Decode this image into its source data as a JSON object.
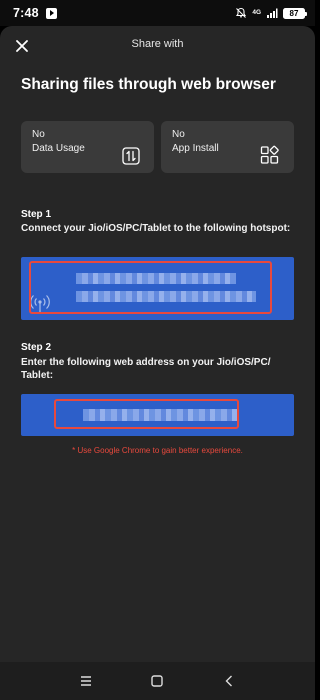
{
  "status_bar": {
    "time": "7:48",
    "network": "4G",
    "battery": "87"
  },
  "header": {
    "title": "Share with"
  },
  "headline": "Sharing files through web browser",
  "features": [
    {
      "line1": "No",
      "line2": "Data Usage",
      "icon": "data-transfer-icon"
    },
    {
      "line1": "No",
      "line2": "App Install",
      "icon": "apps-grid-icon"
    }
  ],
  "step1": {
    "label": "Step 1",
    "description": "Connect your Jio/iOS/PC/Tablet to the following hotspot:"
  },
  "step2": {
    "label": "Step 2",
    "description": "Enter the following web address on your Jio/iOS/PC/ Tablet:"
  },
  "note": "* Use Google Chrome to gain better experience.",
  "colors": {
    "sheet_bg": "#262626",
    "card_bg": "#3a3a3a",
    "accent_blue": "#2d5fc9",
    "highlight_red": "#e8493d"
  }
}
